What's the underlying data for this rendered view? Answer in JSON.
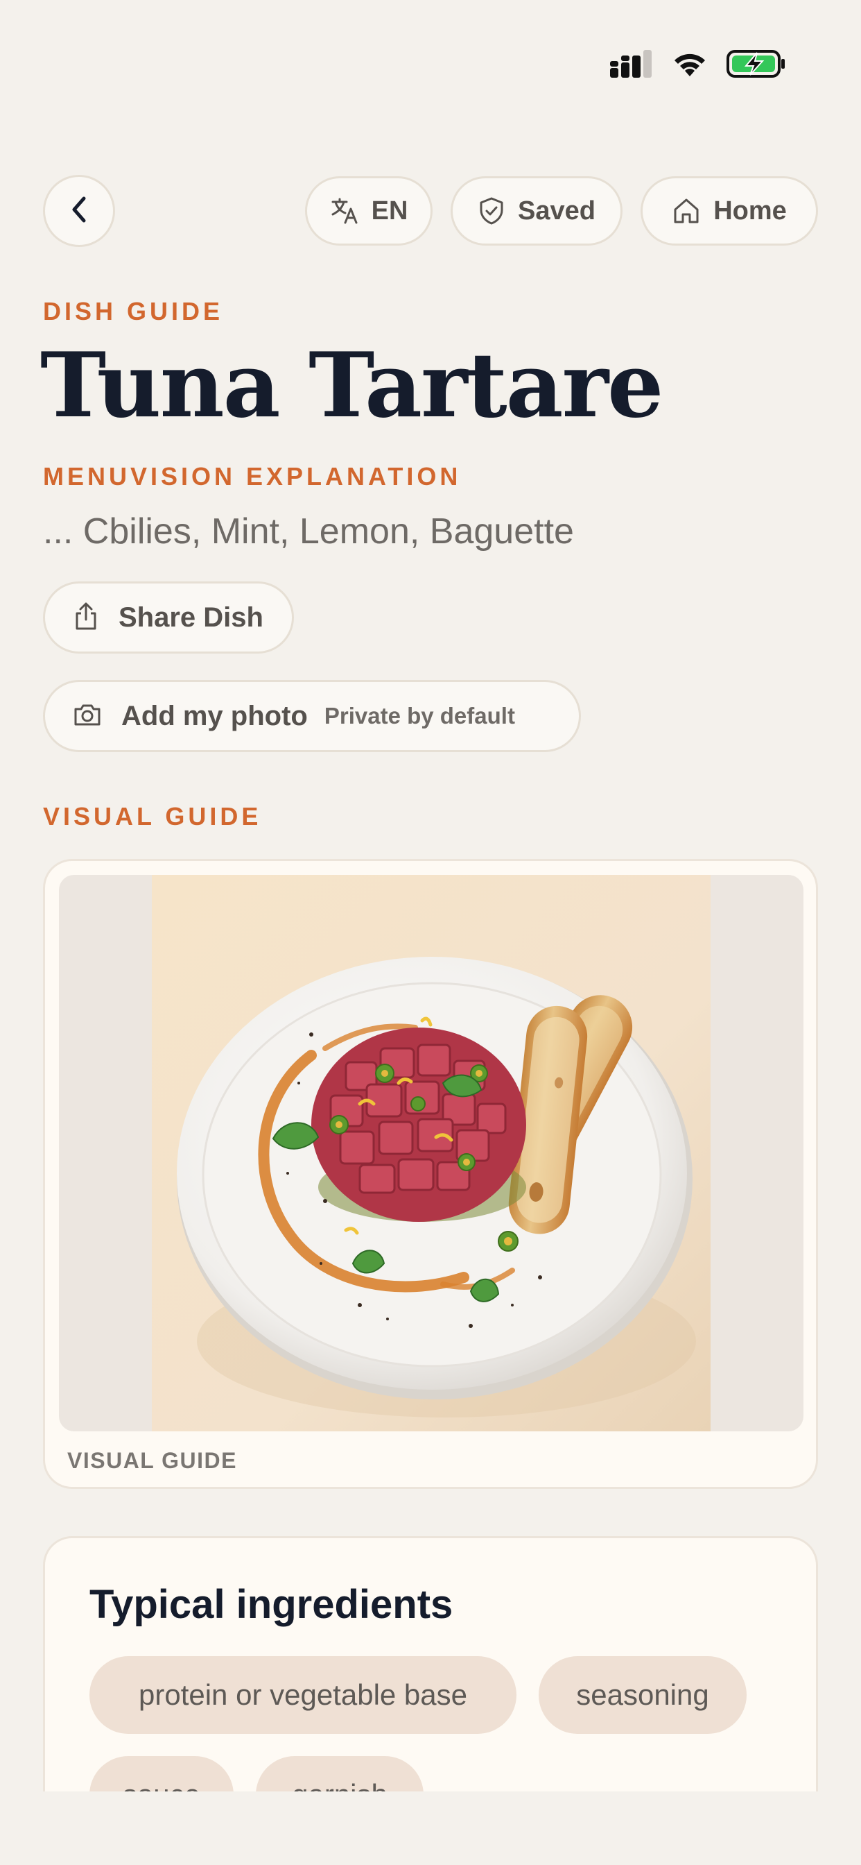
{
  "status_bar": {
    "signal_icon": "cellular-signal-icon",
    "wifi_icon": "wifi-icon",
    "battery_icon": "battery-charging-icon",
    "battery_color": "#34c759"
  },
  "nav": {
    "back_icon": "chevron-left-icon",
    "language_label": "EN",
    "saved_label": "Saved",
    "home_label": "Home"
  },
  "header": {
    "eyebrow": "DISH GUIDE",
    "title": "Tuna Tartare",
    "explanation_eyebrow": "MENUVISION EXPLANATION",
    "subtitle": "... Cbilies, Mint, Lemon, Baguette"
  },
  "actions": {
    "share_label": "Share Dish",
    "photo_label": "Add my photo",
    "photo_note": "Private by default"
  },
  "visual_guide": {
    "section_label": "VISUAL GUIDE",
    "caption": "VISUAL GUIDE"
  },
  "ingredients": {
    "title": "Typical ingredients",
    "chips": [
      "protein or vegetable base",
      "seasoning",
      "sauce",
      "garnish"
    ]
  },
  "colors": {
    "accent": "#d2672e",
    "title": "#151c2c",
    "background": "#f4f1ec",
    "chip": "#efe0d4"
  }
}
